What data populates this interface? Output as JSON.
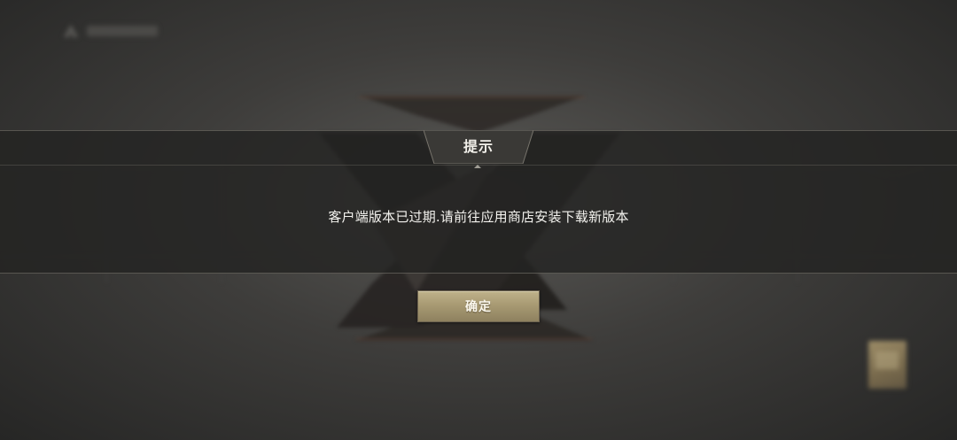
{
  "dialog": {
    "title": "提示",
    "message": "客户端版本已过期.请前往应用商店安装下载新版本",
    "confirm_label": "确定"
  },
  "background": {
    "top_label_icon": "tent-icon",
    "emblem": "crossed-x-emblem",
    "corner_item": "card-thumbnail"
  },
  "colors": {
    "button_gold": "#a89a73",
    "dialog_band": "#232322",
    "text_light": "#f4f3ef"
  }
}
